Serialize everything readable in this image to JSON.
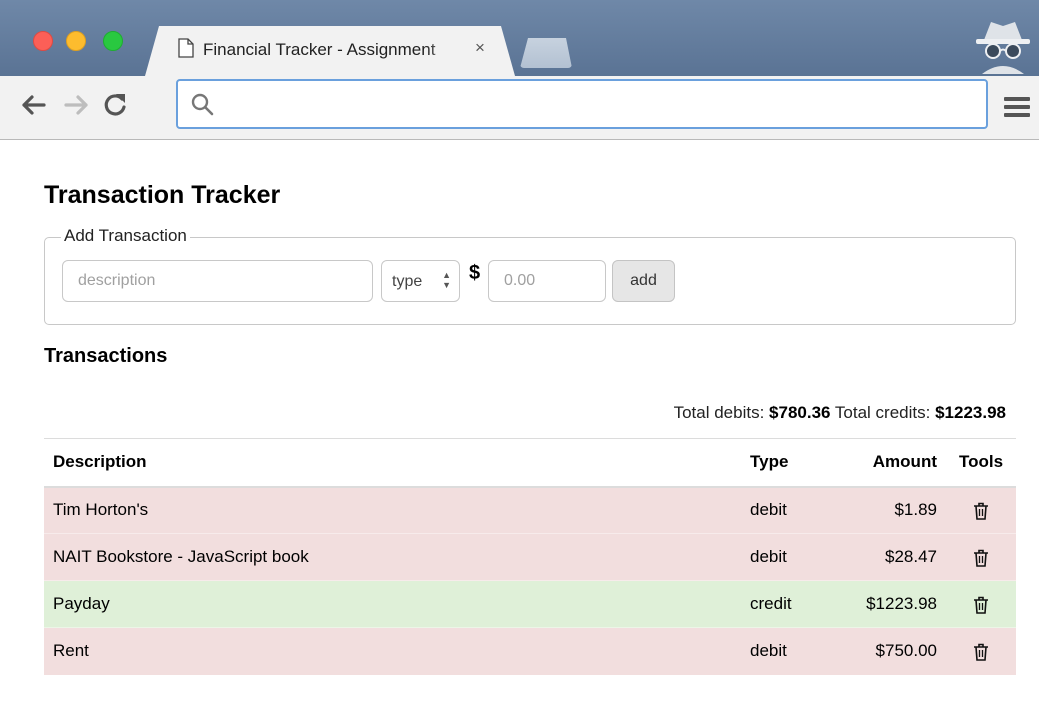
{
  "browser": {
    "tab_title": "Financial Tracker - Assignment",
    "tab_close": "×",
    "address_value": ""
  },
  "page": {
    "title": "Transaction Tracker",
    "add_form": {
      "legend": "Add Transaction",
      "description_placeholder": "description",
      "type_selected": "type",
      "currency_symbol": "$",
      "amount_placeholder": "0.00",
      "add_label": "add"
    },
    "transactions_heading": "Transactions",
    "totals": {
      "debits_label": "Total debits:",
      "debits_value": "$780.36",
      "credits_label": "Total credits:",
      "credits_value": "$1223.98"
    },
    "table": {
      "headers": {
        "description": "Description",
        "type": "Type",
        "amount": "Amount",
        "tools": "Tools"
      },
      "rows": [
        {
          "description": "Tim Horton's",
          "type": "debit",
          "amount": "$1.89"
        },
        {
          "description": "NAIT Bookstore - JavaScript book",
          "type": "debit",
          "amount": "$28.47"
        },
        {
          "description": "Payday",
          "type": "credit",
          "amount": "$1223.98"
        },
        {
          "description": "Rent",
          "type": "debit",
          "amount": "$750.00"
        }
      ]
    }
  },
  "colors": {
    "debit_row": "#f2dede",
    "credit_row": "#dff0d8",
    "omnibox_focus": "#6aa0dd"
  },
  "icons": {
    "back": "arrow-left-icon",
    "forward": "arrow-right-icon",
    "reload": "reload-icon",
    "search": "search-icon",
    "menu": "hamburger-menu-icon",
    "incognito": "incognito-icon",
    "tab_page": "file-icon",
    "delete": "trash-icon"
  }
}
